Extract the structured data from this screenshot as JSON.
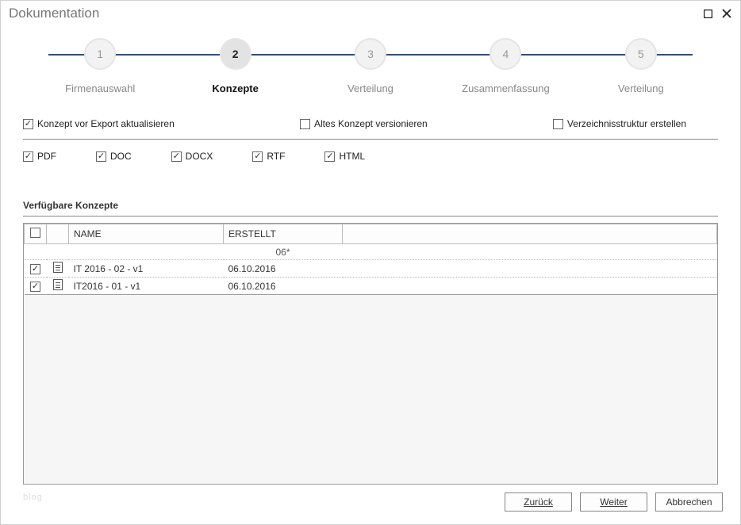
{
  "window": {
    "title": "Dokumentation"
  },
  "stepper": {
    "steps": [
      {
        "num": "1",
        "label": "Firmenauswahl"
      },
      {
        "num": "2",
        "label": "Konzepte"
      },
      {
        "num": "3",
        "label": "Verteilung"
      },
      {
        "num": "4",
        "label": "Zusammenfassung"
      },
      {
        "num": "5",
        "label": "Verteilung"
      }
    ],
    "active_index": 1
  },
  "options": {
    "update_before_export": {
      "label": "Konzept vor Export aktualisieren",
      "checked": true
    },
    "version_old": {
      "label": "Altes Konzept versionieren",
      "checked": false
    },
    "create_dir_structure": {
      "label": "Verzeichnisstruktur erstellen",
      "checked": false
    }
  },
  "formats": {
    "pdf": {
      "label": "PDF",
      "checked": true
    },
    "doc": {
      "label": "DOC",
      "checked": true
    },
    "docx": {
      "label": "DOCX",
      "checked": true
    },
    "rtf": {
      "label": "RTF",
      "checked": true
    },
    "html": {
      "label": "HTML",
      "checked": true
    }
  },
  "section": {
    "title": "Verfügbare Konzepte"
  },
  "table": {
    "headers": {
      "name": "NAME",
      "created": "ERSTELLT"
    },
    "filter": {
      "created": "06*"
    },
    "rows": [
      {
        "checked": true,
        "name": "IT 2016 - 02 - v1",
        "created": "06.10.2016"
      },
      {
        "checked": true,
        "name": "IT2016 - 01 - v1",
        "created": "06.10.2016"
      }
    ]
  },
  "buttons": {
    "back": "Zurück",
    "next": "Weiter",
    "cancel": "Abbrechen"
  },
  "watermark": "blog"
}
